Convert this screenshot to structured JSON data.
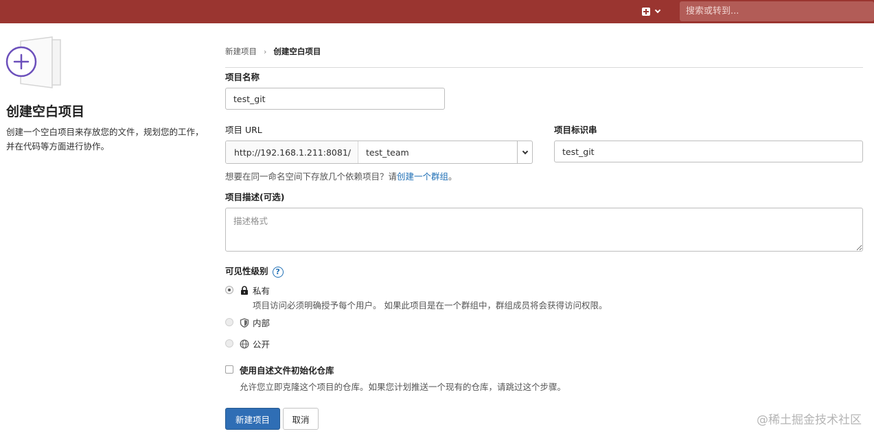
{
  "topbar": {
    "search_placeholder": "搜索或转到..."
  },
  "sidebar": {
    "title": "创建空白项目",
    "description": "创建一个空白项目来存放您的文件，规划您的工作，并在代码等方面进行协作。"
  },
  "breadcrumb": {
    "parent": "新建项目",
    "separator": "›",
    "current": "创建空白项目"
  },
  "form": {
    "project_name_label": "项目名称",
    "project_name_value": "test_git",
    "project_url_label": "项目 URL",
    "url_prefix": "http://192.168.1.211:8081/",
    "namespace_value": "test_team",
    "slug_label": "项目标识串",
    "slug_value": "test_git",
    "group_help_prefix": "想要在同一命名空间下存放几个依赖项目？请",
    "group_help_link": "创建一个群组",
    "group_help_suffix": "。",
    "description_label": "项目描述(可选)",
    "description_placeholder": "描述格式",
    "visibility_label": "可见性级别",
    "visibility_help": "?",
    "visibility_options": [
      {
        "label": "私有",
        "description": "项目访问必须明确授予每个用户。 如果此项目是在一个群组中，群组成员将会获得访问权限。",
        "icon": "lock-icon",
        "checked": true
      },
      {
        "label": "内部",
        "icon": "shield-icon",
        "checked": false
      },
      {
        "label": "公开",
        "icon": "globe-icon",
        "checked": false
      }
    ],
    "readme_label": "使用自述文件初始化仓库",
    "readme_description": "允许您立即克隆这个项目的仓库。如果您计划推送一个现有的仓库，请跳过这个步骤。",
    "submit_label": "新建项目",
    "cancel_label": "取消"
  },
  "watermark": "@稀土掘金技术社区",
  "colors": {
    "topbar": "#9a3530",
    "primary": "#2f6eb5",
    "link": "#1f6fb5",
    "illustration_accent": "#6b4fbb"
  }
}
